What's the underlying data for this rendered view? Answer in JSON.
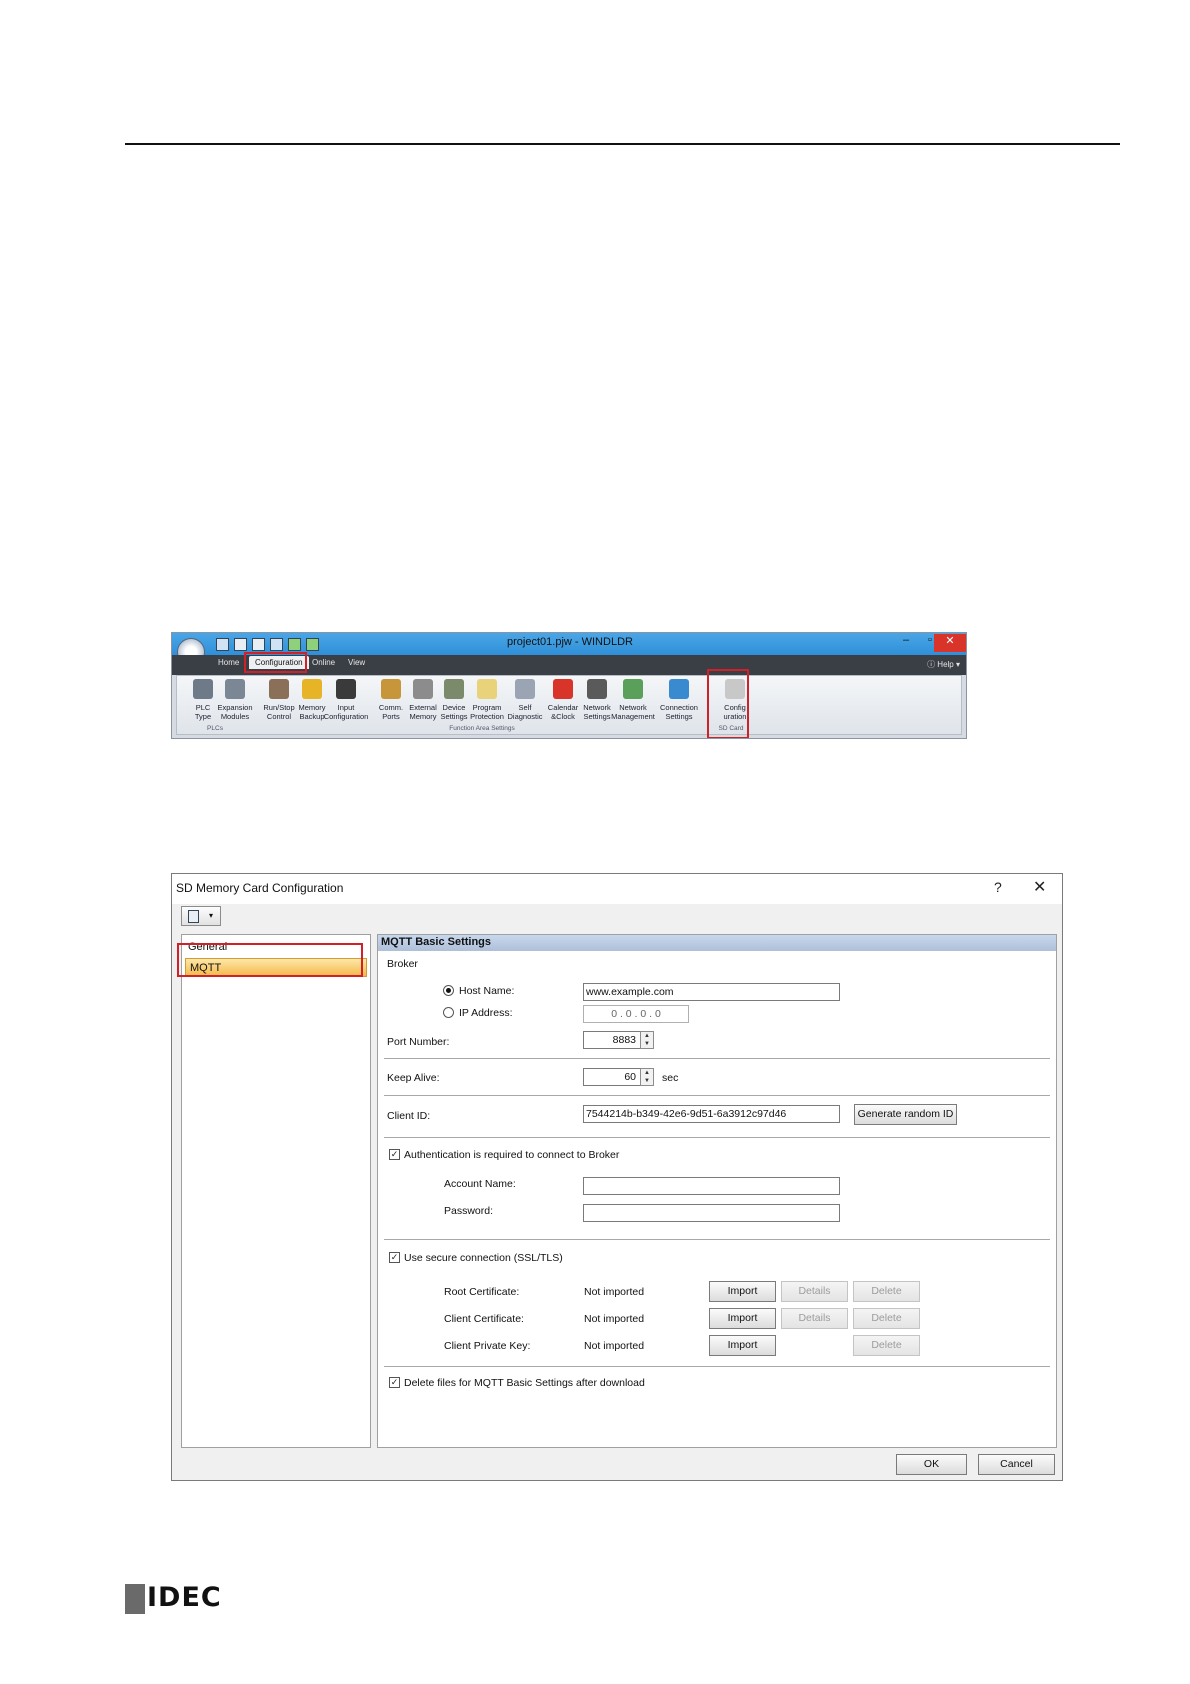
{
  "ribbon": {
    "window_title": "project01.pjw - WINDLDR",
    "tabs": [
      "Home",
      "Configuration",
      "Online",
      "View"
    ],
    "help_label": "Help",
    "buttons": [
      {
        "label1": "PLC",
        "label2": "Type",
        "icon": "plc-type-icon",
        "color": "#6f7a88"
      },
      {
        "label1": "Expansion",
        "label2": "Modules",
        "icon": "expansion-modules-icon",
        "color": "#7c8796"
      },
      {
        "label1": "Run/Stop",
        "label2": "Control",
        "icon": "run-stop-icon",
        "color": "#8a7058"
      },
      {
        "label1": "Memory",
        "label2": "Backup",
        "icon": "memory-backup-icon",
        "color": "#e7b428"
      },
      {
        "label1": "Input",
        "label2": "Configuration",
        "icon": "input-configuration-icon",
        "color": "#3a3a3a"
      },
      {
        "label1": "Comm.",
        "label2": "Ports",
        "icon": "comm-ports-icon",
        "color": "#c8963a"
      },
      {
        "label1": "External",
        "label2": "Memory",
        "icon": "external-memory-icon",
        "color": "#8c8c8c"
      },
      {
        "label1": "Device",
        "label2": "Settings",
        "icon": "device-settings-icon",
        "color": "#7a8a6a"
      },
      {
        "label1": "Program",
        "label2": "Protection",
        "icon": "program-protection-icon",
        "color": "#e8d27a"
      },
      {
        "label1": "Self",
        "label2": "Diagnostic",
        "icon": "self-diagnostic-icon",
        "color": "#9aa4b2"
      },
      {
        "label1": "Calendar",
        "label2": "&Clock",
        "icon": "calendar-clock-icon",
        "color": "#d9342a"
      },
      {
        "label1": "Network",
        "label2": "Settings",
        "icon": "network-settings-icon",
        "color": "#5a5a5a"
      },
      {
        "label1": "Network",
        "label2": "Management",
        "icon": "network-management-icon",
        "color": "#5aa05a"
      },
      {
        "label1": "Connection",
        "label2": "Settings",
        "icon": "connection-settings-icon",
        "color": "#3a8ad0"
      },
      {
        "label1": "Config",
        "label2": "uration",
        "icon": "sd-config-icon",
        "color": "#c8c8c8"
      }
    ],
    "groups": [
      "PLCs",
      "Function Area Settings",
      "SD Card"
    ]
  },
  "dialog": {
    "title": "SD Memory Card Configuration",
    "help_glyph": "?",
    "close_glyph": "✕",
    "tree": {
      "general": "General",
      "mqtt": "MQTT"
    },
    "section_header": "MQTT Basic Settings",
    "broker_label": "Broker",
    "host_name_label": "Host Name:",
    "host_name_value": "www.example.com",
    "ip_address_label": "IP Address:",
    "ip_address_value": "0 . 0 . 0 . 0",
    "port_label": "Port Number:",
    "port_value": "8883",
    "keep_alive_label": "Keep Alive:",
    "keep_alive_value": "60",
    "keep_alive_unit": "sec",
    "client_id_label": "Client ID:",
    "client_id_value": "7544214b-b349-42e6-9d51-6a3912c97d46",
    "generate_button": "Generate random ID",
    "auth_checkbox": "Authentication is required to connect to Broker",
    "account_label": "Account Name:",
    "password_label": "Password:",
    "ssl_checkbox": "Use secure connection (SSL/TLS)",
    "certs": [
      {
        "label": "Root Certificate:",
        "status": "Not imported"
      },
      {
        "label": "Client Certificate:",
        "status": "Not imported"
      },
      {
        "label": "Client Private Key:",
        "status": "Not imported"
      }
    ],
    "import_label": "Import",
    "details_label": "Details",
    "delete_label": "Delete",
    "delete_files_checkbox": "Delete files for MQTT Basic Settings after download",
    "ok_label": "OK",
    "cancel_label": "Cancel"
  },
  "logo": {
    "text": "IDEC"
  }
}
